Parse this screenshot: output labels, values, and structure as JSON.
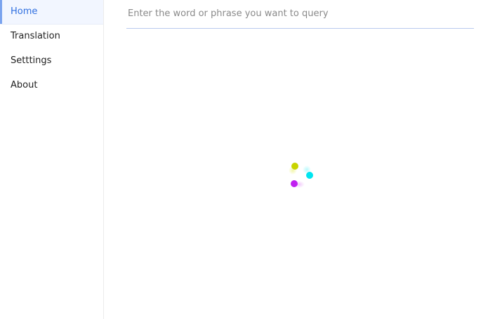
{
  "sidebar": {
    "items": [
      {
        "label": "Home",
        "active": true
      },
      {
        "label": "Translation",
        "active": false
      },
      {
        "label": "Setttings",
        "active": false
      },
      {
        "label": "About",
        "active": false
      }
    ]
  },
  "search": {
    "placeholder": "Enter the word or phrase you want to query",
    "value": ""
  },
  "loader": {
    "icon": "loading-spinner-icon",
    "colors": [
      "#c8d400",
      "#00e5f0",
      "#c020f0"
    ]
  }
}
